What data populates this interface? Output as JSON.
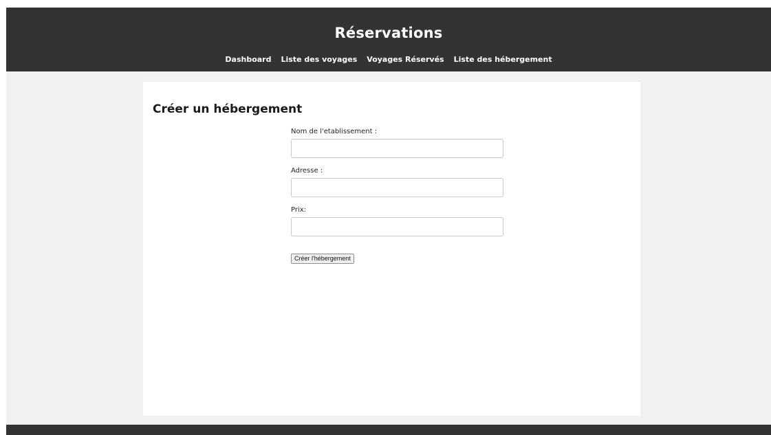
{
  "header": {
    "title": "Réservations",
    "nav": [
      {
        "label": "Dashboard"
      },
      {
        "label": "Liste des voyages"
      },
      {
        "label": "Voyages Réservés"
      },
      {
        "label": "Liste des hébergement"
      }
    ]
  },
  "main": {
    "title": "Créer un hébergement",
    "form": {
      "name_label": "Nom de l'etablissement :",
      "name_value": "",
      "address_label": "Adresse :",
      "address_value": "",
      "price_label": "Prix:",
      "price_value": "",
      "submit_label": "Créer l'hébergement"
    }
  },
  "colors": {
    "header_bg": "#333333",
    "page_bg": "#f1f1f1",
    "card_bg": "#ffffff"
  }
}
